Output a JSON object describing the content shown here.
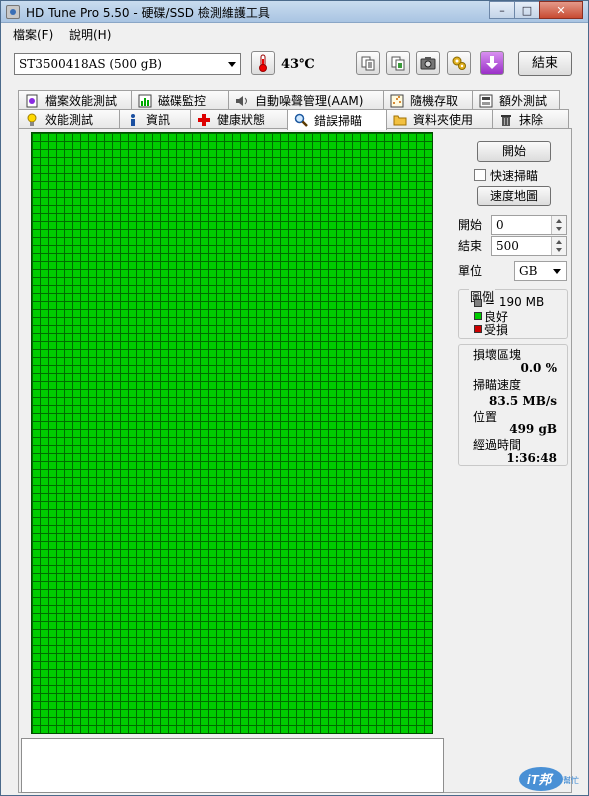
{
  "window": {
    "title": "HD Tune Pro 5.50 - 硬碟/SSD 檢測維護工具",
    "controls": {
      "minimize": "–",
      "maximize": "□",
      "close": "✕"
    }
  },
  "menu": {
    "file": "檔案(F)",
    "help": "說明(H)"
  },
  "toolbar": {
    "drive": "ST3500418AS (500 gB)",
    "temperature": "43℃",
    "exit": "結束",
    "icons": [
      "thermometer-icon",
      "copy-text-icon",
      "copy-image-icon",
      "camera-icon",
      "settings-icon",
      "download-icon"
    ]
  },
  "tabs": {
    "top_row": [
      {
        "label": "檔案效能測試",
        "icon": "file-benchmark-icon"
      },
      {
        "label": "磁碟監控",
        "icon": "disk-monitor-icon"
      },
      {
        "label": "自動噪聲管理(AAM)",
        "icon": "speaker-icon"
      },
      {
        "label": "隨機存取",
        "icon": "random-access-icon"
      },
      {
        "label": "額外測試",
        "icon": "extra-tests-icon"
      }
    ],
    "bottom_row": [
      {
        "label": "效能測試",
        "icon": "benchmark-icon",
        "active": false
      },
      {
        "label": "資訊",
        "icon": "info-icon",
        "active": false
      },
      {
        "label": "健康狀態",
        "icon": "health-icon",
        "active": false
      },
      {
        "label": "錯誤掃瞄",
        "icon": "magnifier-icon",
        "active": true
      },
      {
        "label": "資料夾使用",
        "icon": "folder-icon",
        "active": false
      },
      {
        "label": "抹除",
        "icon": "trash-icon",
        "active": false
      }
    ]
  },
  "scan": {
    "start_button": "開始",
    "quick_scan_label": "快速掃瞄",
    "quick_scan_checked": false,
    "speed_map_button": "速度地圖",
    "start_label": "開始",
    "start_value": "0",
    "end_label": "結束",
    "end_value": "500",
    "unit_label": "單位",
    "unit_value": "GB"
  },
  "legend": {
    "title": "圖例",
    "block_size": "= 190 MB",
    "good": "良好",
    "damaged": "受損",
    "colors": {
      "block": "#808080",
      "good": "#00cc00",
      "damaged": "#cc0000"
    }
  },
  "stats": {
    "damaged_blocks_label": "損壞區塊",
    "damaged_blocks_value": "0.0 %",
    "scan_speed_label": "掃瞄速度",
    "scan_speed_value": "83.5 MB/s",
    "position_label": "位置",
    "position_value": "499 gB",
    "elapsed_label": "經過時間",
    "elapsed_value": "1:36:48"
  },
  "scan_map": {
    "state": "all blocks good",
    "color": "#00cc00",
    "grid_line_color": "#006b00"
  },
  "watermark": {
    "brand": "iT邦",
    "sub": "幫忙"
  }
}
